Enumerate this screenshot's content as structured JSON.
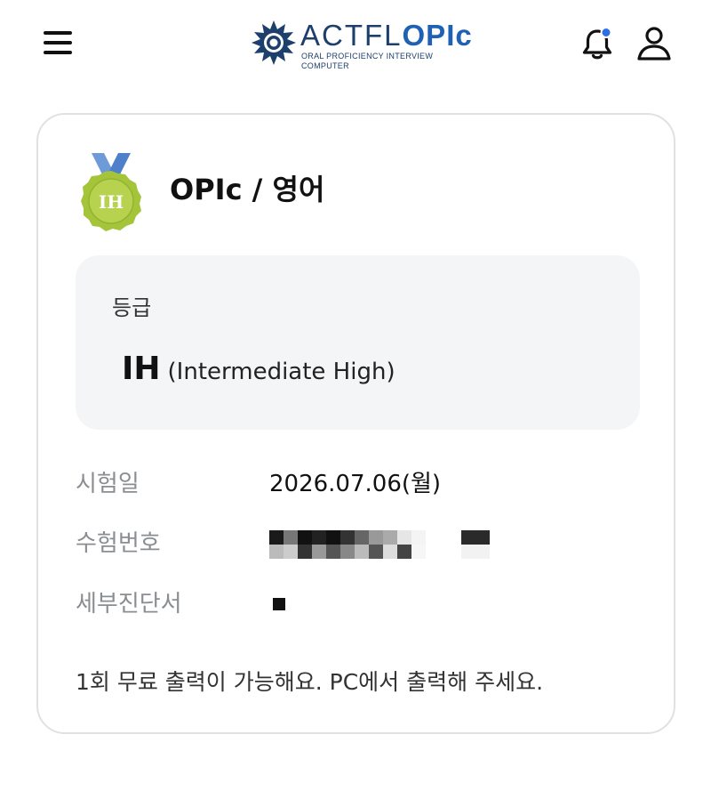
{
  "header": {
    "menu_icon": "hamburger-menu-icon",
    "logo": {
      "brand": "ACTFL",
      "product": "OPIc",
      "tagline_line1": "ORAL PROFICIENCY INTERVIEW",
      "tagline_line2": "COMPUTER"
    },
    "notification_icon": "bell-icon",
    "notification_dot_color": "#2f6fe4",
    "profile_icon": "user-icon"
  },
  "card": {
    "medal_text": "IH",
    "title": "OPIc / 영어",
    "grade": {
      "label": "등급",
      "code": "IH",
      "name": "(Intermediate High)"
    },
    "details": [
      {
        "label": "시험일",
        "value": "2026.07.06(월)"
      },
      {
        "label": "수험번호",
        "value": ""
      },
      {
        "label": "세부진단서",
        "value": ""
      }
    ],
    "notice": "1회 무료 출력이 가능해요. PC에서 출력해 주세요."
  },
  "colors": {
    "medal_green": "#a4c43a",
    "ribbon_blue": "#6e9ad8",
    "logo_navy": "#1d3f6c",
    "logo_blue": "#1f62b5",
    "card_border": "#dfe1e4",
    "grade_box_bg": "#f3f5f7",
    "label_gray": "#8a8d91"
  }
}
